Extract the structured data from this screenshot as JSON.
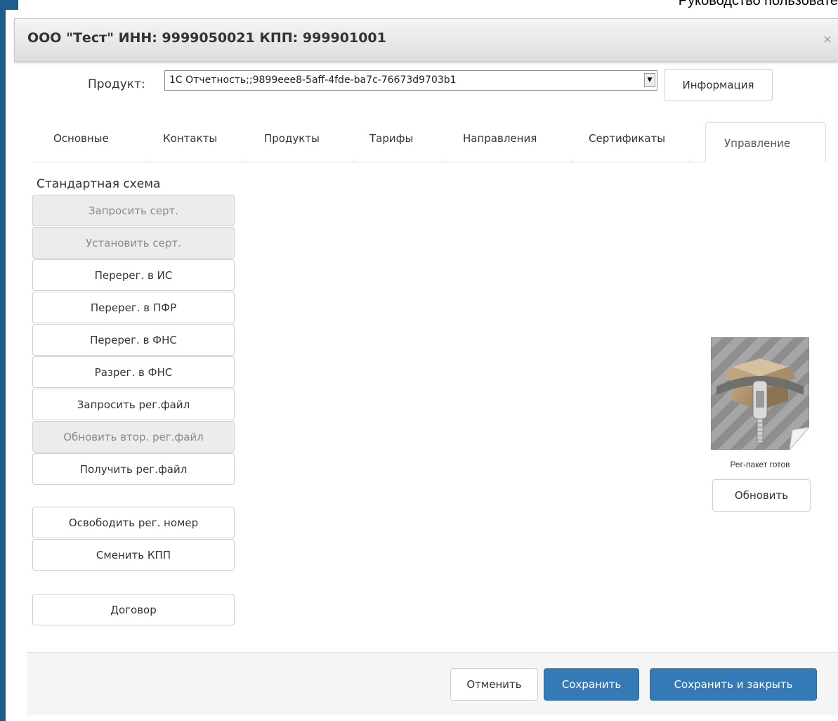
{
  "document": {
    "header_text": "Руководство пользовате"
  },
  "dialog": {
    "title": "ООО \"Тест\" ИНН: 9999050021 КПП: 999901001",
    "close_symbol": "×"
  },
  "product": {
    "label": "Продукт:",
    "selected_value": "1С Отчетность;;9899eee8-5aff-4fde-ba7c-76673d9703b1",
    "info_button": "Информация"
  },
  "tabs": [
    {
      "label": "Основные"
    },
    {
      "label": "Контакты"
    },
    {
      "label": "Продукты"
    },
    {
      "label": "Тарифы"
    },
    {
      "label": "Направления"
    },
    {
      "label": "Сертификаты"
    },
    {
      "label": "Управление",
      "active": true
    }
  ],
  "management": {
    "scheme_title": "Стандартная схема",
    "buttons": [
      {
        "label": "Запросить серт.",
        "disabled": true
      },
      {
        "label": "Установить серт.",
        "disabled": true
      },
      {
        "label": "Перерег. в ИС",
        "disabled": false
      },
      {
        "label": "Перерег. в ПФР",
        "disabled": false
      },
      {
        "label": "Перерег. в ФНС",
        "disabled": false
      },
      {
        "label": "Разрег. в ФНС",
        "disabled": false
      },
      {
        "label": "Запросить рег.файл",
        "disabled": false
      },
      {
        "label": "Обновить втор. рег.файл",
        "disabled": true
      },
      {
        "label": "Получить рег.файл",
        "disabled": false
      },
      {
        "label": "Освободить рег. номер",
        "disabled": false
      },
      {
        "label": "Сменить КПП",
        "disabled": false
      },
      {
        "label": "Договор",
        "disabled": false
      }
    ],
    "reg_package": {
      "icon": "archive-zip-icon",
      "caption": "Рег-пакет готов",
      "refresh_button": "Обновить"
    }
  },
  "footer": {
    "cancel": "Отменить",
    "save": "Сохранить",
    "save_close": "Сохранить и закрыть"
  },
  "colors": {
    "primary": "#337ab7",
    "frame": "#1f5d8c",
    "disabled_bg": "#ececec"
  }
}
